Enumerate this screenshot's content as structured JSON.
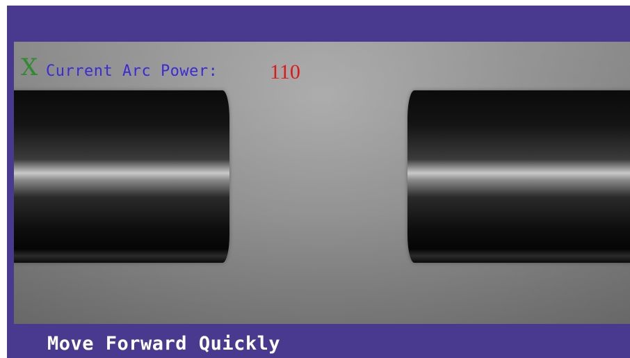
{
  "overlay": {
    "axis_label": "X",
    "arc_power_label": "Current Arc Power:",
    "arc_power_value": "110"
  },
  "status_bar": {
    "message": "Move Forward Quickly"
  },
  "colors": {
    "frame": "#4a3a8f",
    "axis_label": "#2e8b2e",
    "arc_label": "#3a2bd6",
    "arc_value": "#e01818",
    "status_text": "#ffffff"
  }
}
